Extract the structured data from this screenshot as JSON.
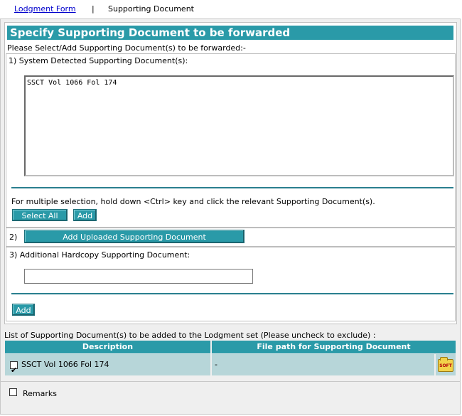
{
  "tabs": {
    "lodgment_form": "Lodgment Form",
    "separator": "|",
    "supporting_document": "Supporting Document"
  },
  "panel": {
    "title": "Specify Supporting Document to be forwarded",
    "instruction": "Please Select/Add Supporting Document(s) to be forwarded:-",
    "section1_label": "1)  System Detected Supporting Document(s):",
    "detected_items": [
      "SSCT Vol 1066 Fol 174"
    ],
    "multi_select_hint": "For multiple selection, hold down <Ctrl> key and click the relevant Supporting Document(s).",
    "select_all_button": "Select All",
    "add_button_1": "Add",
    "section2_number": "2)",
    "add_uploaded_button": "Add Uploaded Supporting Document",
    "section3_label": "3)  Additional Hardcopy Supporting Document:",
    "hardcopy_value": "",
    "add_button_2": "Add"
  },
  "list": {
    "title": "List of Supporting Document(s) to be added to the Lodgment set (Please uncheck to exclude) :",
    "columns": [
      "Description",
      "File path for Supporting Document"
    ],
    "rows": [
      {
        "checked": true,
        "description": "SSCT Vol 1066 Fol 174",
        "file_path": "-",
        "icon": "soft-document-icon",
        "icon_text": "SOFT"
      }
    ]
  },
  "remarks": {
    "label": "Remarks",
    "checked": false
  },
  "colors": {
    "accent": "#2a9aa8",
    "row_bg": "#b7d6d9",
    "link": "#0000cc"
  }
}
